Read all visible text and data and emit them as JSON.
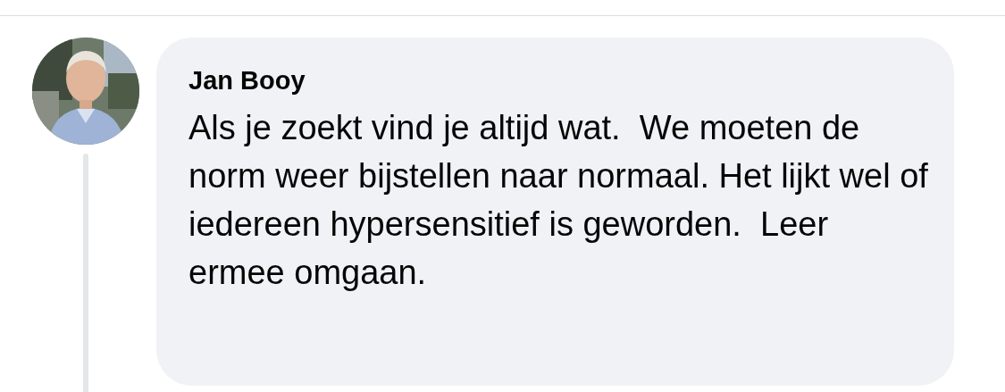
{
  "comment": {
    "author": "Jan Booy",
    "text": "Als je zoekt vind je altijd wat.  We moeten de norm weer bijstellen naar normaal. Het lijkt wel of iedereen hypersensitief is geworden.  Leer ermee omgaan."
  }
}
